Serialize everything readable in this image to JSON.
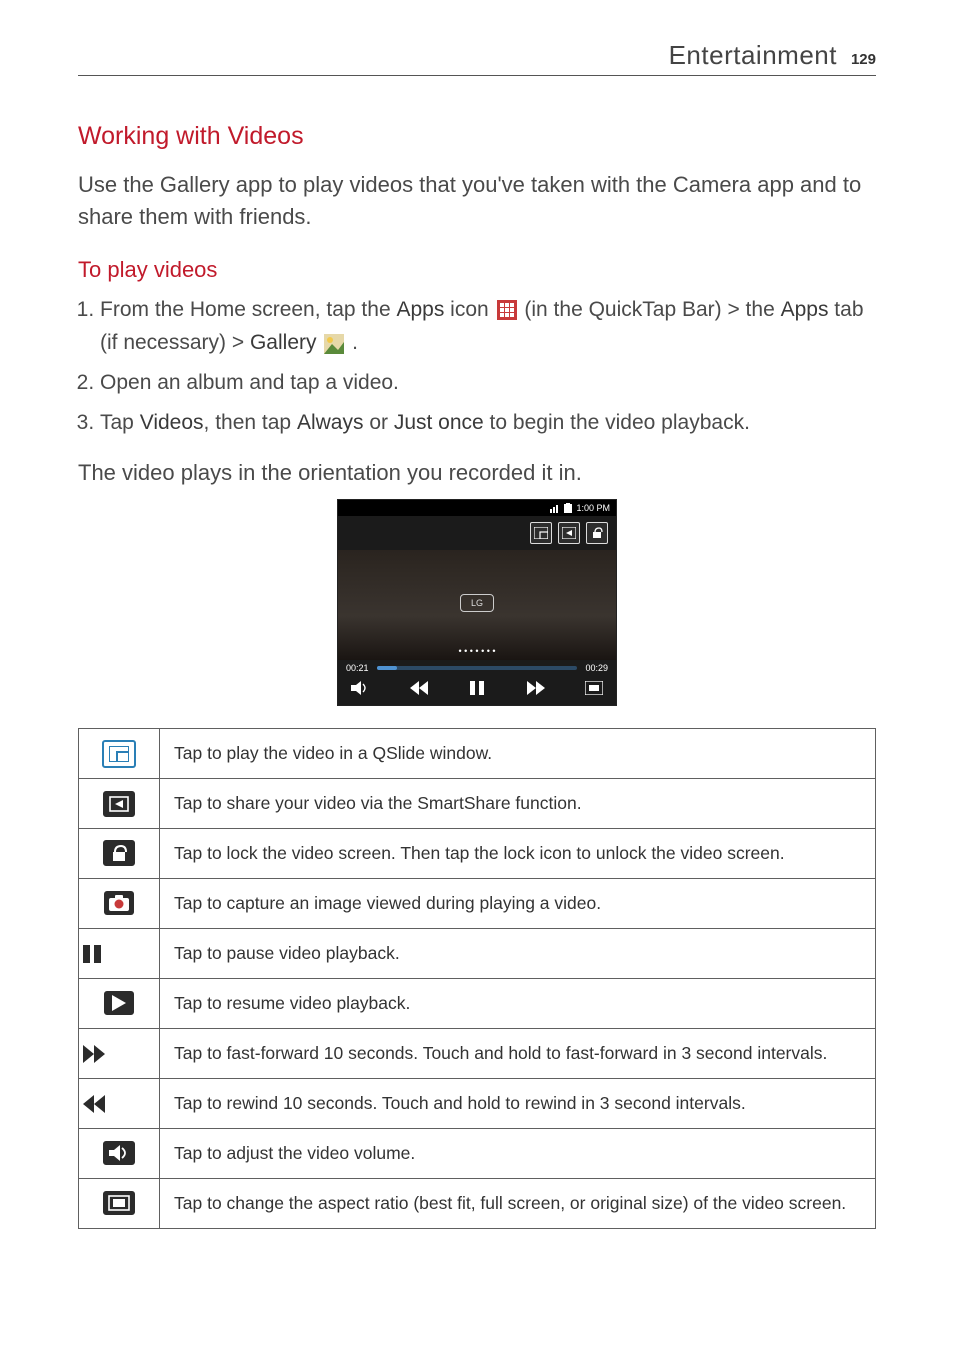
{
  "header": {
    "section": "Entertainment",
    "page_number": "129"
  },
  "section_title": "Working with Videos",
  "intro": "Use the Gallery app to play videos that you've taken with the Camera app and to share them with friends.",
  "sub_title": "To play videos",
  "steps": {
    "s1a": "From the Home screen, tap the ",
    "s1b": "Apps",
    "s1c": " icon ",
    "s1d": " (in the QuickTap Bar) > the ",
    "s1e": "Apps",
    "s1f": " tab (if necessary) > ",
    "s1g": "Gallery",
    "s1h": " .",
    "s2": "Open an album and tap a video.",
    "s3a": "Tap ",
    "s3b": "Videos",
    "s3c": ", then tap ",
    "s3d": "Always",
    "s3e": " or ",
    "s3f": "Just once",
    "s3g": " to begin the video playback."
  },
  "note": "The video plays in the orientation you recorded it in.",
  "screenshot": {
    "time": "1:00 PM",
    "left_time": "00:21",
    "right_time": "00:29",
    "center_label": "LG"
  },
  "table": {
    "r1": "Tap to play the video in a QSlide window.",
    "r2": "Tap to share your video via the SmartShare function.",
    "r3": "Tap to lock the video screen. Then tap the lock icon to unlock the video screen.",
    "r4": "Tap to capture an image viewed during playing a video.",
    "r5": "Tap to pause video playback.",
    "r6": "Tap to resume video playback.",
    "r7": "Tap to fast-forward 10 seconds. Touch and hold to fast-forward in 3 second intervals.",
    "r8": "Tap to rewind 10 seconds. Touch and hold to rewind in 3 second intervals.",
    "r9": "Tap to adjust the video volume.",
    "r10": "Tap to change the aspect ratio (best fit, full screen, or original size) of the video screen."
  }
}
